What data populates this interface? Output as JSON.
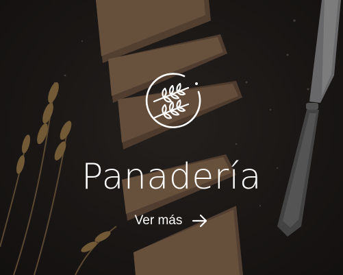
{
  "card": {
    "title": "Panadería",
    "cta_label": "Ver más",
    "emblem_icon": "wheat-circle-icon",
    "cta_icon": "arrow-right-icon",
    "background": "bread-loaf-wheat-knife-photo",
    "colors": {
      "text": "#ffffff",
      "background_dark": "#1f1c1a"
    }
  }
}
